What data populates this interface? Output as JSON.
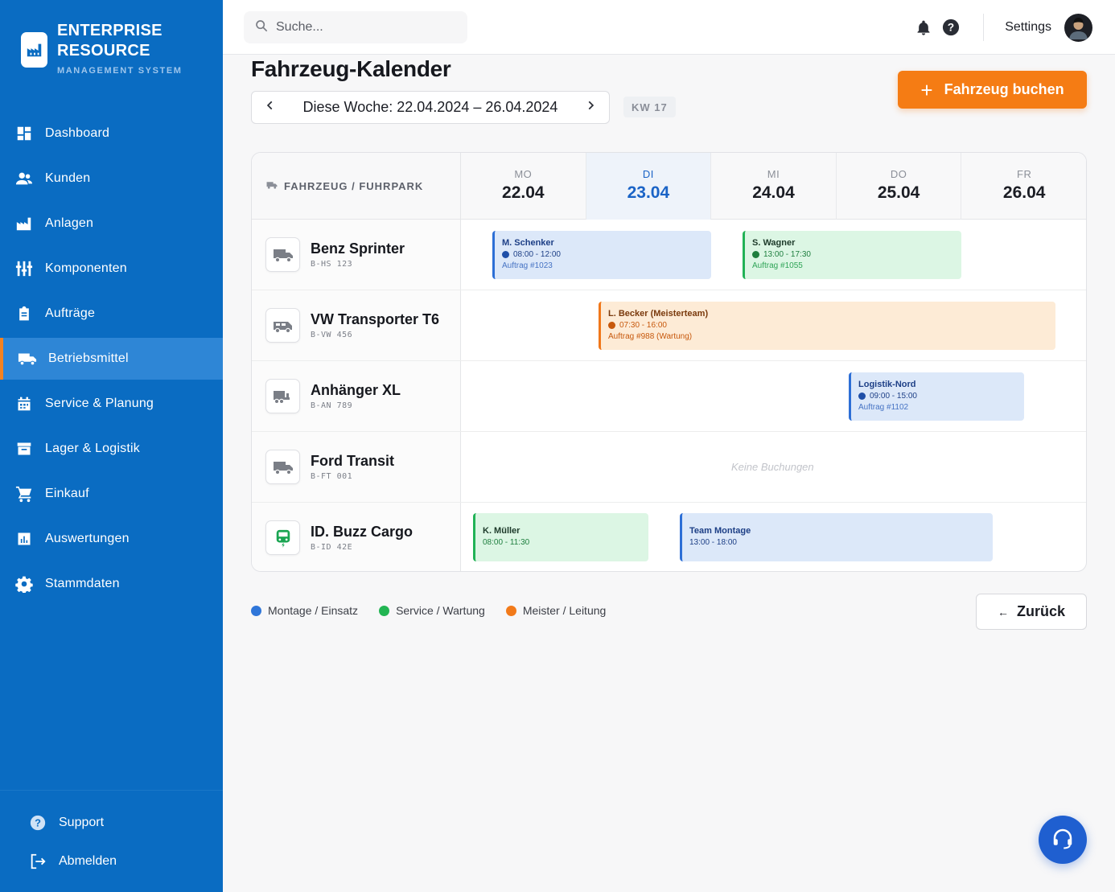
{
  "brand": {
    "line1": "ENTERPRISE",
    "line2": "RESOURCE",
    "sub": "MANAGEMENT SYSTEM"
  },
  "sidebar": {
    "items": [
      {
        "label": "Dashboard",
        "icon": "dashboard-icon"
      },
      {
        "label": "Kunden",
        "icon": "users-icon"
      },
      {
        "label": "Anlagen",
        "icon": "factory-icon"
      },
      {
        "label": "Komponenten",
        "icon": "components-icon"
      },
      {
        "label": "Aufträge",
        "icon": "clipboard-icon"
      },
      {
        "label": "Betriebsmittel",
        "icon": "truck-icon",
        "active": true
      },
      {
        "label": "Service & Planung",
        "icon": "calendar-icon"
      },
      {
        "label": "Lager & Logistik",
        "icon": "archive-icon"
      },
      {
        "label": "Einkauf",
        "icon": "cart-icon"
      },
      {
        "label": "Auswertungen",
        "icon": "chart-icon"
      },
      {
        "label": "Stammdaten",
        "icon": "gear-icon"
      }
    ],
    "bottom": [
      {
        "label": "Support",
        "icon": "help-icon"
      },
      {
        "label": "Abmelden",
        "icon": "logout-icon"
      }
    ]
  },
  "topbar": {
    "search_placeholder": "Suche...",
    "settings_label": "Settings"
  },
  "page": {
    "title": "Fahrzeug-Kalender",
    "week_label": "Diese Woche: 22.04.2024 – 26.04.2024",
    "kw": "KW 17",
    "book_label": "Fahrzeug buchen",
    "back_label": "Zurück"
  },
  "calendar": {
    "vehicle_header": "FAHRZEUG / FUHRPARK",
    "days": [
      {
        "name": "MO",
        "date": "22.04"
      },
      {
        "name": "DI",
        "date": "23.04",
        "today": true
      },
      {
        "name": "MI",
        "date": "24.04"
      },
      {
        "name": "DO",
        "date": "25.04"
      },
      {
        "name": "FR",
        "date": "26.04"
      }
    ],
    "vehicles": [
      {
        "name": "Benz Sprinter",
        "plate": "B-HS 123",
        "icon": "truck-icon"
      },
      {
        "name": "VW Transporter T6",
        "plate": "B-VW 456",
        "icon": "van-icon"
      },
      {
        "name": "Anhänger XL",
        "plate": "B-AN 789",
        "icon": "trailer-icon"
      },
      {
        "name": "Ford Transit",
        "plate": "B-FT 001",
        "icon": "truck-icon"
      },
      {
        "name": "ID. Buzz Cargo",
        "plate": "B-ID 42E",
        "icon": "ev-bus-icon"
      }
    ],
    "bookings": [
      {
        "who": "M. Schenker",
        "time": "08:00 - 12:00",
        "order": "Auftrag #1023",
        "color": "blue"
      },
      {
        "who": "S. Wagner",
        "time": "13:00 - 17:30",
        "order": "Auftrag #1055",
        "color": "green"
      },
      {
        "who": "L. Becker (Meisterteam)",
        "time": "07:30 - 16:00",
        "order": "Auftrag #988 (Wartung)",
        "color": "orange"
      },
      {
        "who": "Logistik-Nord",
        "time": "09:00 - 15:00",
        "order": "Auftrag #1102",
        "color": "blue"
      },
      {
        "who": "K. Müller",
        "time": "08:00 - 11:30",
        "color": "green"
      },
      {
        "who": "Team Montage",
        "time": "13:00 - 18:00",
        "color": "blue"
      }
    ],
    "empty_label": "Keine Buchungen"
  },
  "legend": [
    {
      "label": "Montage / Einsatz",
      "color": "#2f76d9"
    },
    {
      "label": "Service / Wartung",
      "color": "#22b553"
    },
    {
      "label": "Meister / Leitung",
      "color": "#f27a1a"
    }
  ]
}
